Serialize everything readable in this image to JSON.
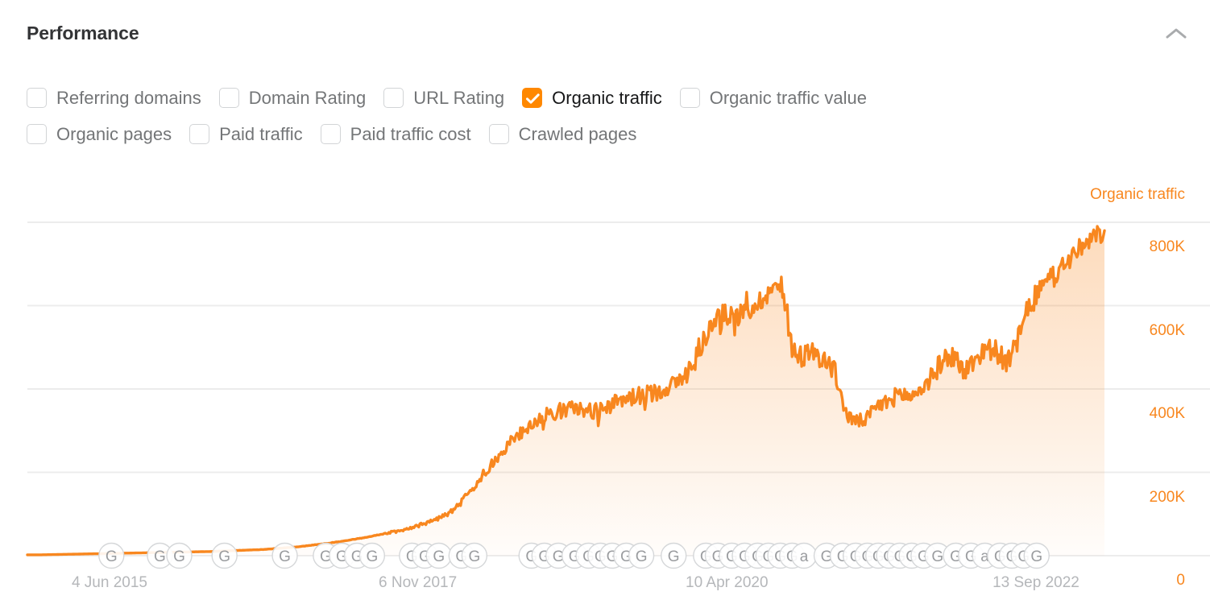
{
  "panel": {
    "title": "Performance",
    "collapse_icon": "chevron-up-icon"
  },
  "metrics": [
    {
      "label": "Referring domains",
      "checked": false
    },
    {
      "label": "Domain Rating",
      "checked": false
    },
    {
      "label": "URL Rating",
      "checked": false
    },
    {
      "label": "Organic traffic",
      "checked": true
    },
    {
      "label": "Organic traffic value",
      "checked": false
    },
    {
      "label": "Organic pages",
      "checked": false
    },
    {
      "label": "Paid traffic",
      "checked": false
    },
    {
      "label": "Paid traffic cost",
      "checked": false
    },
    {
      "label": "Crawled pages",
      "checked": false
    }
  ],
  "colors": {
    "accent": "#ff8800",
    "series": "#f8871f",
    "grid": "#ececec",
    "label_muted": "#b5b7ba",
    "title": "#333436"
  },
  "chart_data": {
    "type": "area",
    "title": "",
    "series_name": "Organic traffic",
    "legend_position": "top-right",
    "grid": true,
    "xlabel": "",
    "ylabel": "Organic traffic",
    "ylim": [
      0,
      900000
    ],
    "ytick_labels": [
      "800K",
      "600K",
      "400K",
      "200K",
      "0"
    ],
    "ytick_values": [
      800000,
      600000,
      400000,
      200000,
      0
    ],
    "xtick_labels": [
      "4 Jun 2015",
      "6 Nov 2017",
      "10 Apr 2020",
      "13 Sep 2022"
    ],
    "xtick_positions": [
      0.08,
      0.365,
      0.65,
      0.935
    ],
    "x_range": [
      "4 Jun 2015",
      "2024"
    ],
    "annotation_markers": {
      "description": "Google algorithm update markers along the x axis",
      "types": [
        "G",
        "a"
      ],
      "items": [
        {
          "pos": 0.078,
          "glyph": "G"
        },
        {
          "pos": 0.123,
          "glyph": "G"
        },
        {
          "pos": 0.141,
          "glyph": "G"
        },
        {
          "pos": 0.183,
          "glyph": "G"
        },
        {
          "pos": 0.239,
          "glyph": "G"
        },
        {
          "pos": 0.277,
          "glyph": "G"
        },
        {
          "pos": 0.292,
          "glyph": "G"
        },
        {
          "pos": 0.306,
          "glyph": "G"
        },
        {
          "pos": 0.32,
          "glyph": "G"
        },
        {
          "pos": 0.357,
          "glyph": "G"
        },
        {
          "pos": 0.369,
          "glyph": "G"
        },
        {
          "pos": 0.382,
          "glyph": "G"
        },
        {
          "pos": 0.403,
          "glyph": "G"
        },
        {
          "pos": 0.415,
          "glyph": "G"
        },
        {
          "pos": 0.468,
          "glyph": "G"
        },
        {
          "pos": 0.48,
          "glyph": "G"
        },
        {
          "pos": 0.493,
          "glyph": "G"
        },
        {
          "pos": 0.508,
          "glyph": "G"
        },
        {
          "pos": 0.521,
          "glyph": "G"
        },
        {
          "pos": 0.532,
          "glyph": "G"
        },
        {
          "pos": 0.543,
          "glyph": "G"
        },
        {
          "pos": 0.556,
          "glyph": "G"
        },
        {
          "pos": 0.57,
          "glyph": "G"
        },
        {
          "pos": 0.6,
          "glyph": "G"
        },
        {
          "pos": 0.63,
          "glyph": "G"
        },
        {
          "pos": 0.641,
          "glyph": "G"
        },
        {
          "pos": 0.654,
          "glyph": "G"
        },
        {
          "pos": 0.666,
          "glyph": "G"
        },
        {
          "pos": 0.678,
          "glyph": "G"
        },
        {
          "pos": 0.688,
          "glyph": "G"
        },
        {
          "pos": 0.699,
          "glyph": "G"
        },
        {
          "pos": 0.71,
          "glyph": "G"
        },
        {
          "pos": 0.721,
          "glyph": "a"
        },
        {
          "pos": 0.742,
          "glyph": "G"
        },
        {
          "pos": 0.757,
          "glyph": "G"
        },
        {
          "pos": 0.769,
          "glyph": "G"
        },
        {
          "pos": 0.78,
          "glyph": "G"
        },
        {
          "pos": 0.79,
          "glyph": "G"
        },
        {
          "pos": 0.8,
          "glyph": "G"
        },
        {
          "pos": 0.81,
          "glyph": "G"
        },
        {
          "pos": 0.821,
          "glyph": "G"
        },
        {
          "pos": 0.832,
          "glyph": "G"
        },
        {
          "pos": 0.845,
          "glyph": "G"
        },
        {
          "pos": 0.862,
          "glyph": "G"
        },
        {
          "pos": 0.876,
          "glyph": "G"
        },
        {
          "pos": 0.889,
          "glyph": "a"
        },
        {
          "pos": 0.903,
          "glyph": "G"
        },
        {
          "pos": 0.914,
          "glyph": "G"
        },
        {
          "pos": 0.925,
          "glyph": "G"
        },
        {
          "pos": 0.937,
          "glyph": "G"
        }
      ]
    },
    "x": [
      0.0,
      0.01,
      0.02,
      0.03,
      0.04,
      0.05,
      0.06,
      0.07,
      0.08,
      0.09,
      0.1,
      0.11,
      0.12,
      0.13,
      0.14,
      0.15,
      0.16,
      0.17,
      0.18,
      0.19,
      0.2,
      0.21,
      0.22,
      0.23,
      0.24,
      0.25,
      0.26,
      0.27,
      0.28,
      0.29,
      0.3,
      0.31,
      0.32,
      0.33,
      0.34,
      0.35,
      0.36,
      0.37,
      0.38,
      0.39,
      0.4,
      0.41,
      0.42,
      0.43,
      0.44,
      0.45,
      0.46,
      0.47,
      0.48,
      0.49,
      0.5,
      0.51,
      0.52,
      0.53,
      0.54,
      0.55,
      0.56,
      0.57,
      0.58,
      0.59,
      0.6,
      0.61,
      0.62,
      0.63,
      0.64,
      0.65,
      0.66,
      0.67,
      0.68,
      0.69,
      0.7,
      0.71,
      0.72,
      0.73,
      0.74,
      0.75,
      0.76,
      0.77,
      0.78,
      0.79,
      0.8,
      0.81,
      0.82,
      0.83,
      0.84,
      0.85,
      0.86,
      0.87,
      0.88,
      0.89,
      0.9,
      0.91,
      0.92,
      0.93,
      0.94,
      0.95,
      0.96,
      0.97,
      0.98,
      0.99,
      1.0
    ],
    "values": [
      2000,
      2000,
      2500,
      3000,
      3500,
      4000,
      4500,
      5000,
      5500,
      6000,
      6500,
      7000,
      7500,
      8000,
      8500,
      9000,
      9500,
      10000,
      11000,
      12000,
      13000,
      14000,
      15000,
      17000,
      19000,
      21000,
      24000,
      27000,
      30000,
      34000,
      38000,
      42000,
      47000,
      52000,
      57000,
      63000,
      70000,
      78000,
      88000,
      100000,
      120000,
      150000,
      185000,
      215000,
      245000,
      275000,
      300000,
      320000,
      335000,
      345000,
      350000,
      355000,
      345000,
      350000,
      360000,
      370000,
      380000,
      385000,
      390000,
      400000,
      410000,
      430000,
      470000,
      530000,
      570000,
      580000,
      575000,
      590000,
      610000,
      640000,
      645000,
      500000,
      480000,
      490000,
      470000,
      440000,
      340000,
      320000,
      330000,
      360000,
      370000,
      390000,
      380000,
      400000,
      430000,
      470000,
      480000,
      440000,
      470000,
      500000,
      490000,
      460000,
      520000,
      600000,
      640000,
      660000,
      690000,
      720000,
      740000,
      760000,
      780000
    ]
  }
}
